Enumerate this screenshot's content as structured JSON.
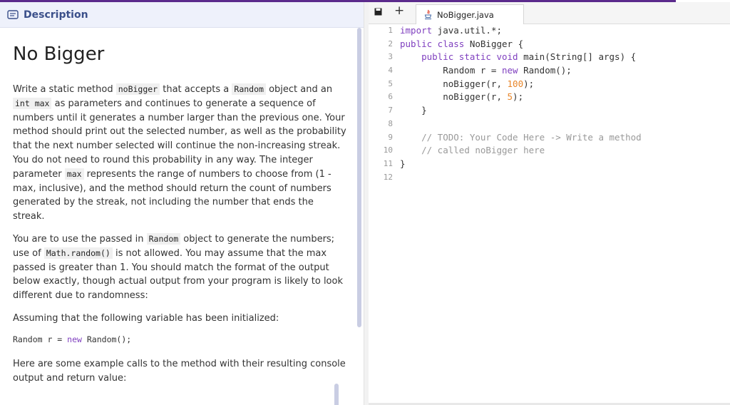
{
  "description_panel": {
    "header_label": "Description",
    "title": "No Bigger",
    "paragraph1": [
      {
        "t": "text",
        "v": "Write a static method "
      },
      {
        "t": "code",
        "v": "noBigger"
      },
      {
        "t": "text",
        "v": " that accepts a "
      },
      {
        "t": "code",
        "v": "Random"
      },
      {
        "t": "text",
        "v": " object and an "
      },
      {
        "t": "code",
        "v": "int max"
      },
      {
        "t": "text",
        "v": " as parameters and continues to generate a sequence of numbers until it generates a number larger than the previous one. Your method should print out the selected number, as well as the probability that the next number selected will continue the non-increasing streak. You do not need to round this probability in any way. The integer parameter "
      },
      {
        "t": "code",
        "v": "max"
      },
      {
        "t": "text",
        "v": " represents the range of numbers to choose from (1 - max, inclusive), and the method should return the count of numbers generated by the streak, not including the number that ends the streak."
      }
    ],
    "paragraph2": [
      {
        "t": "text",
        "v": "You are to use the passed in "
      },
      {
        "t": "code",
        "v": "Random"
      },
      {
        "t": "text",
        "v": " object to generate the numbers; use of "
      },
      {
        "t": "code",
        "v": "Math.random()"
      },
      {
        "t": "text",
        "v": " is not allowed. You may assume that the max passed is greater than 1. You should match the format of the output below exactly, though actual output from your program is likely to look different due to randomness:"
      }
    ],
    "paragraph3": "Assuming that the following variable has been initialized:",
    "code_example": {
      "before": "Random r = ",
      "keyword": "new",
      "after": " Random();"
    },
    "paragraph4": "Here are some example calls to the method with their resulting console output and return value:"
  },
  "editor": {
    "file_tab": "NoBigger.java",
    "new_tab_label": "+",
    "line_numbers": [
      "1",
      "2",
      "3",
      "4",
      "5",
      "6",
      "7",
      "8",
      "9",
      "10",
      "11",
      "12"
    ],
    "lines": [
      [
        {
          "k": "k",
          "v": "import"
        },
        {
          "k": "p",
          "v": " java.util.*;"
        }
      ],
      [
        {
          "k": "k",
          "v": "public class"
        },
        {
          "k": "p",
          "v": " NoBigger {"
        }
      ],
      [
        {
          "k": "p",
          "v": "    "
        },
        {
          "k": "k",
          "v": "public static void"
        },
        {
          "k": "p",
          "v": " main(String[] args) {"
        }
      ],
      [
        {
          "k": "p",
          "v": "        Random r = "
        },
        {
          "k": "k",
          "v": "new"
        },
        {
          "k": "p",
          "v": " Random();"
        }
      ],
      [
        {
          "k": "p",
          "v": "        noBigger(r, "
        },
        {
          "k": "n",
          "v": "100"
        },
        {
          "k": "p",
          "v": ");"
        }
      ],
      [
        {
          "k": "p",
          "v": "        noBigger(r, "
        },
        {
          "k": "n",
          "v": "5"
        },
        {
          "k": "p",
          "v": ");"
        }
      ],
      [
        {
          "k": "p",
          "v": "    }"
        }
      ],
      [
        {
          "k": "p",
          "v": ""
        }
      ],
      [
        {
          "k": "p",
          "v": "    "
        },
        {
          "k": "c",
          "v": "// TODO: Your Code Here -> Write a method"
        }
      ],
      [
        {
          "k": "p",
          "v": "    "
        },
        {
          "k": "c",
          "v": "// called noBigger here"
        }
      ],
      [
        {
          "k": "p",
          "v": "}"
        }
      ],
      [
        {
          "k": "p",
          "v": ""
        }
      ]
    ]
  },
  "colors": {
    "accent": "#5b2a8c",
    "keyword": "#7f3fbf",
    "number": "#e8862a",
    "comment": "#999999",
    "header_bg": "#eef1fb"
  }
}
